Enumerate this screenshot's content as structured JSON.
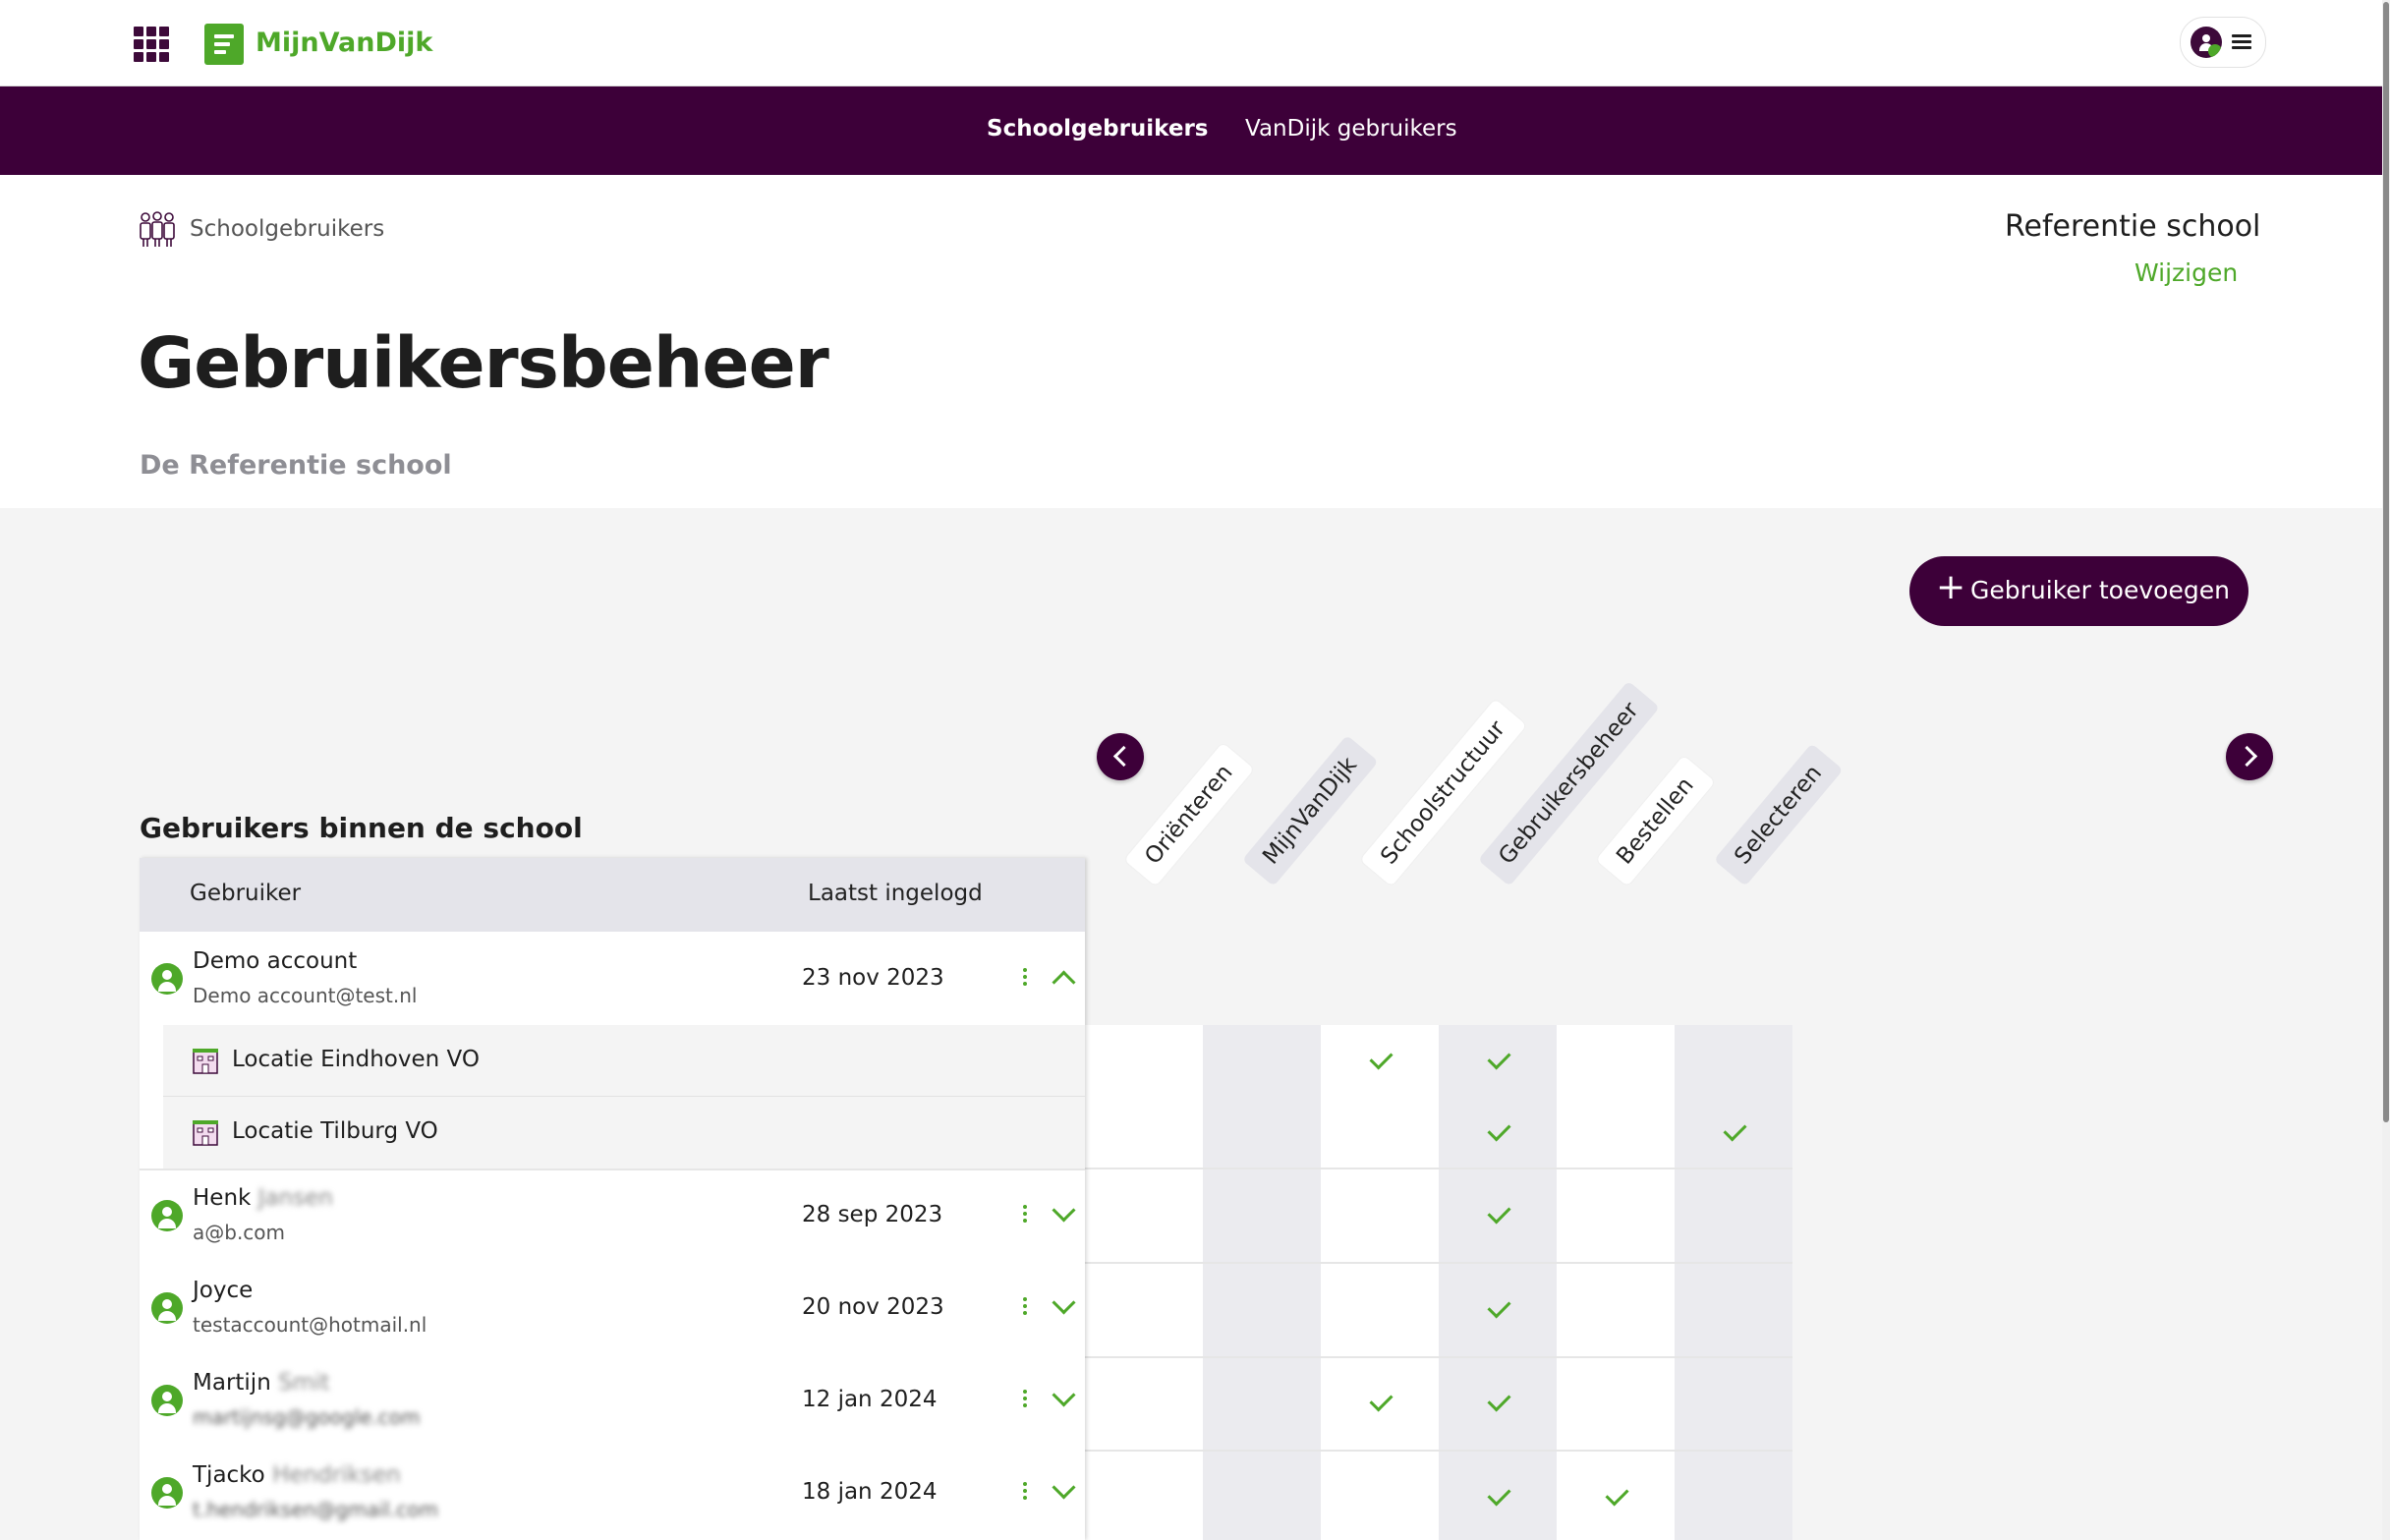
{
  "app": {
    "logo_text": "MijnVanDijk"
  },
  "nav": {
    "tabs": [
      {
        "label": "Schoolgebruikers",
        "active": true
      },
      {
        "label": "VanDijk gebruikers",
        "active": false
      }
    ]
  },
  "breadcrumb": {
    "label": "Schoolgebruikers"
  },
  "school": {
    "name": "Referentie school",
    "change_label": "Wijzigen"
  },
  "page": {
    "title": "Gebruikersbeheer",
    "subtitle": "De Referentie school"
  },
  "actions": {
    "add_user_label": "Gebruiker toevoegen"
  },
  "section": {
    "title": "Gebruikers binnen de school"
  },
  "table": {
    "headers": {
      "user": "Gebruiker",
      "last_login": "Laatst ingelogd"
    },
    "permission_columns": [
      "Oriënteren",
      "MijnVanDijk",
      "Schoolstructuur",
      "Gebruikersbeheer",
      "Bestellen",
      "Selecteren"
    ],
    "users": [
      {
        "name": "Demo account",
        "email": "Demo account@test.nl",
        "last_login": "23 nov 2023",
        "expanded": true,
        "locations": [
          {
            "name": "Locatie Eindhoven VO",
            "permissions": [
              false,
              false,
              true,
              true,
              false,
              false
            ]
          },
          {
            "name": "Locatie Tilburg VO",
            "permissions": [
              false,
              false,
              false,
              true,
              false,
              true
            ]
          }
        ]
      },
      {
        "name": "Henk",
        "name_hidden": "Jansen",
        "email": "a@b.com",
        "last_login": "28 sep 2023",
        "expanded": false,
        "permissions": [
          false,
          false,
          false,
          true,
          false,
          false
        ]
      },
      {
        "name": "Joyce",
        "email": "testaccount@hotmail.nl",
        "last_login": "20 nov 2023",
        "expanded": false,
        "permissions": [
          false,
          false,
          false,
          true,
          false,
          false
        ]
      },
      {
        "name": "Martijn",
        "name_hidden": "Smit",
        "email_hidden": "martijnsg@google.com",
        "last_login": "12 jan 2024",
        "expanded": false,
        "permissions": [
          false,
          false,
          true,
          true,
          false,
          false
        ]
      },
      {
        "name": "Tjacko",
        "name_hidden": "Hendriksen",
        "email_hidden": "t.hendriksen@gmail.com",
        "last_login": "18 jan 2024",
        "expanded": false,
        "permissions": [
          false,
          false,
          false,
          true,
          true,
          false
        ]
      }
    ]
  },
  "colors": {
    "brand_purple": "#3d0039",
    "brand_green": "#4ea829"
  },
  "icons": {
    "apps": "grid-icon",
    "menu": "hamburger-icon",
    "user": "user-icon",
    "location": "building-icon",
    "more": "kebab-icon",
    "expand": "chevron-down-icon",
    "collapse": "chevron-up-icon",
    "check": "check-icon"
  }
}
